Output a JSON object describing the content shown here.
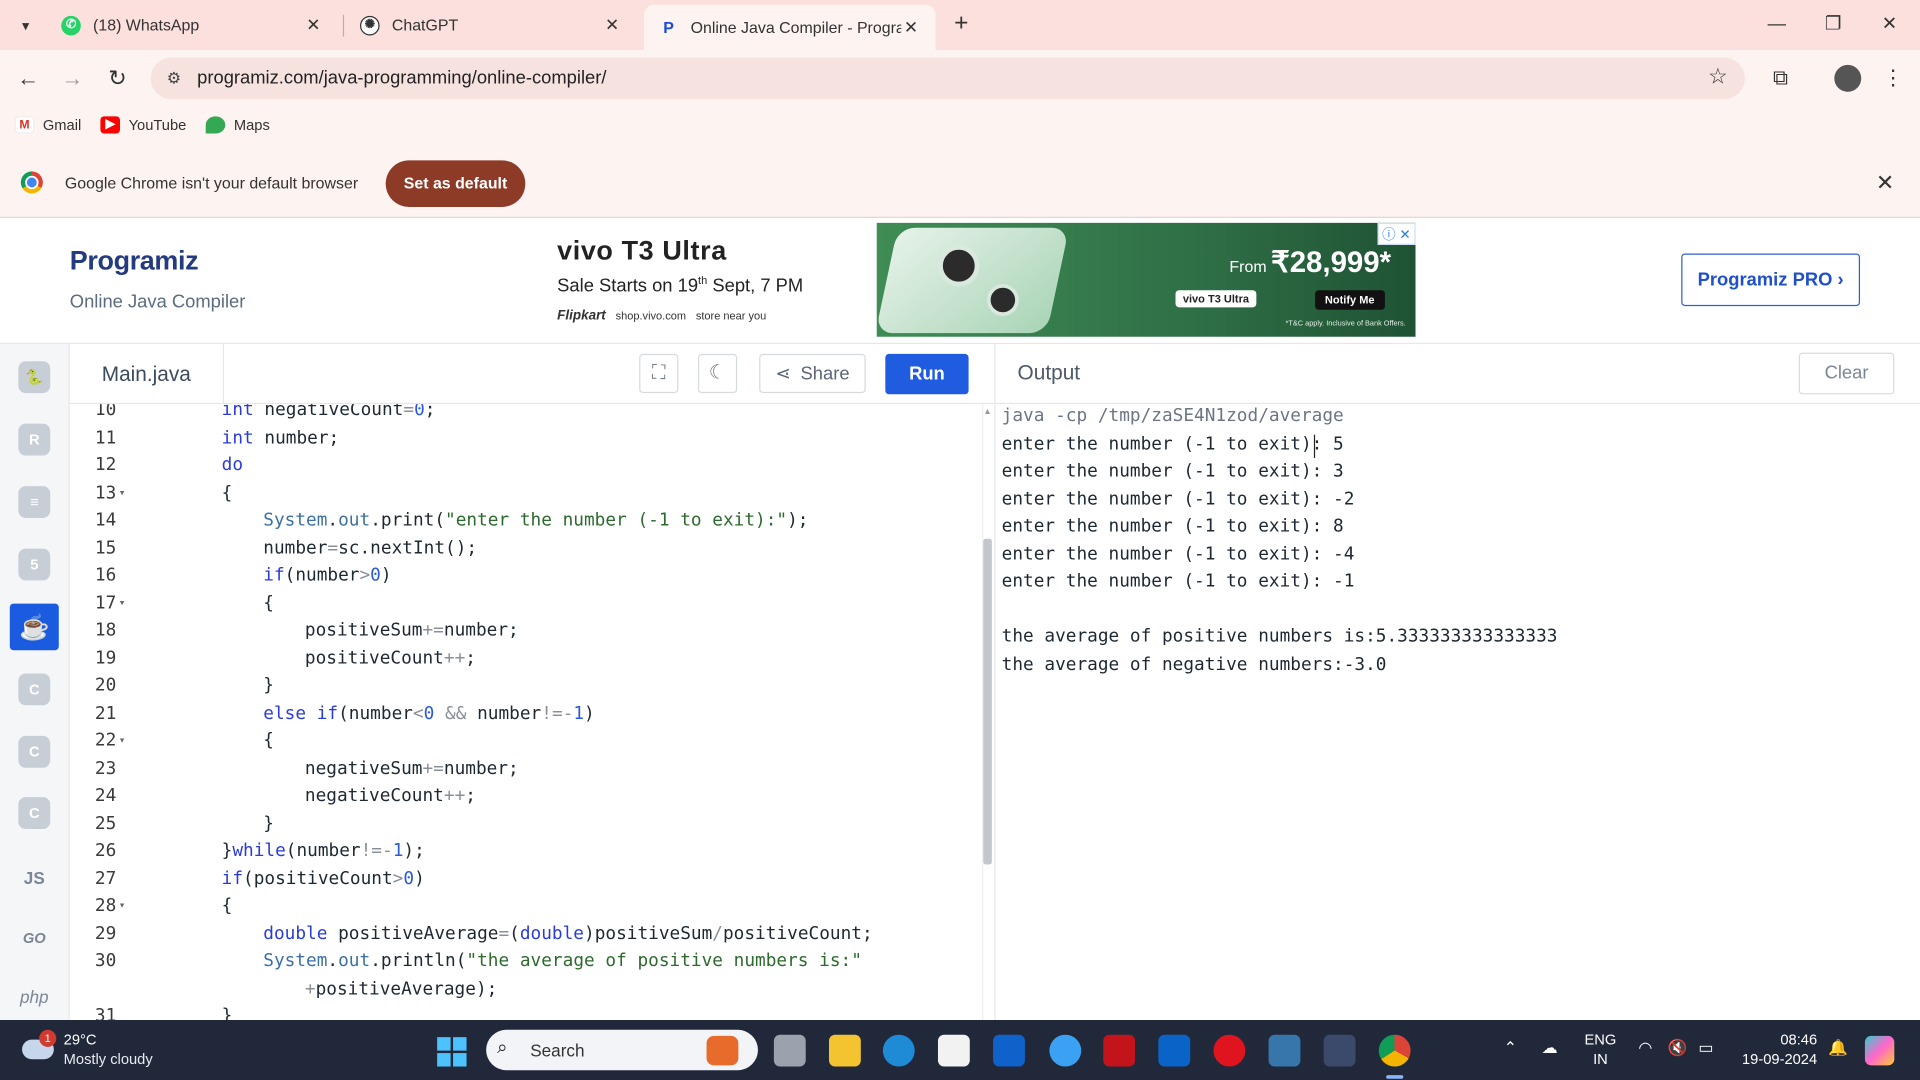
{
  "browser": {
    "tabs": [
      {
        "title": "(18) WhatsApp",
        "icon": "whatsapp-icon",
        "color": "#25d366"
      },
      {
        "title": "ChatGPT",
        "icon": "chatgpt-icon",
        "color": "#333333"
      },
      {
        "title": "Online Java Compiler - Program",
        "icon": "programiz-icon",
        "color": "#1a4bd6"
      }
    ],
    "url": "programiz.com/java-programming/online-compiler/",
    "bookmarks": [
      "Gmail",
      "YouTube",
      "Maps"
    ],
    "infobar_message": "Google Chrome isn't your default browser",
    "infobar_button": "Set as default"
  },
  "header": {
    "logo": "Programiz",
    "subtitle": "Online Java Compiler",
    "pro_button": "Programiz PRO ›"
  },
  "ad": {
    "brand": "vivo T3 Ultra",
    "sale_prefix": "Sale Starts on 19",
    "sale_sup": "th",
    "sale_suffix": " Sept, 7 PM",
    "partner": "Flipkart",
    "links": [
      "shop.vivo.com",
      "store near you"
    ],
    "price_prefix": "From ",
    "price": "₹28,999*",
    "chip": "vivo T3 Ultra",
    "notify": "Notify Me",
    "tnc": "*T&C apply. Inclusive of Bank Offers."
  },
  "languages": [
    "python",
    "r",
    "sql",
    "html",
    "java",
    "c",
    "cpp",
    "csharp",
    "js",
    "go",
    "php"
  ],
  "rail_text": {
    "js": "JS",
    "go": "GO",
    "php": "php"
  },
  "editor": {
    "filename": "Main.java",
    "share": "Share",
    "run": "Run",
    "lines": [
      {
        "n": "10",
        "fold": false,
        "indent": 0,
        "code": "int negativeCount=0;"
      },
      {
        "n": "11",
        "fold": false,
        "indent": 0,
        "code": "int number;"
      },
      {
        "n": "12",
        "fold": false,
        "indent": 0,
        "code": "do"
      },
      {
        "n": "13",
        "fold": true,
        "indent": 0,
        "code": "{"
      },
      {
        "n": "14",
        "fold": false,
        "indent": 1,
        "code": "System.out.print(\"enter the number (-1 to exit):\");"
      },
      {
        "n": "15",
        "fold": false,
        "indent": 1,
        "code": "number=sc.nextInt();"
      },
      {
        "n": "16",
        "fold": false,
        "indent": 1,
        "code": "if(number>0)"
      },
      {
        "n": "17",
        "fold": true,
        "indent": 1,
        "code": "{"
      },
      {
        "n": "18",
        "fold": false,
        "indent": 2,
        "code": "positiveSum+=number;"
      },
      {
        "n": "19",
        "fold": false,
        "indent": 2,
        "code": "positiveCount++;"
      },
      {
        "n": "20",
        "fold": false,
        "indent": 1,
        "code": "}"
      },
      {
        "n": "21",
        "fold": false,
        "indent": 1,
        "code": "else if(number<0 && number!=-1)"
      },
      {
        "n": "22",
        "fold": true,
        "indent": 1,
        "code": "{"
      },
      {
        "n": "23",
        "fold": false,
        "indent": 2,
        "code": "negativeSum+=number;"
      },
      {
        "n": "24",
        "fold": false,
        "indent": 2,
        "code": "negativeCount++;"
      },
      {
        "n": "25",
        "fold": false,
        "indent": 1,
        "code": "}"
      },
      {
        "n": "26",
        "fold": false,
        "indent": 0,
        "code": "}while(number!=-1);"
      },
      {
        "n": "27",
        "fold": false,
        "indent": 0,
        "code": "if(positiveCount>0)"
      },
      {
        "n": "28",
        "fold": true,
        "indent": 0,
        "code": "{"
      },
      {
        "n": "29",
        "fold": false,
        "indent": 1,
        "code": "double positiveAverage=(double)positiveSum/positiveCount;"
      },
      {
        "n": "30",
        "fold": false,
        "indent": 1,
        "code": "System.out.println(\"the average of positive numbers is:\""
      },
      {
        "n": "",
        "fold": false,
        "indent": 2,
        "code": "+positiveAverage);"
      },
      {
        "n": "31",
        "fold": false,
        "indent": 0,
        "code": "}"
      }
    ]
  },
  "output": {
    "label": "Output",
    "clear": "Clear",
    "lines": [
      "java -cp /tmp/zaSE4N1zod/average",
      "enter the number (-1 to exit): 5",
      "enter the number (-1 to exit): 3",
      "enter the number (-1 to exit): -2",
      "enter the number (-1 to exit): 8",
      "enter the number (-1 to exit): -4",
      "enter the number (-1 to exit): -1",
      "",
      "the average of positive numbers is:5.333333333333333",
      "the average of negative numbers:-3.0"
    ]
  },
  "taskbar": {
    "temperature": "29°C",
    "condition": "Mostly cloudy",
    "weather_badge": "1",
    "search": "Search",
    "lang_line1": "ENG",
    "lang_line2": "IN",
    "time": "08:46",
    "date": "19-09-2024"
  }
}
